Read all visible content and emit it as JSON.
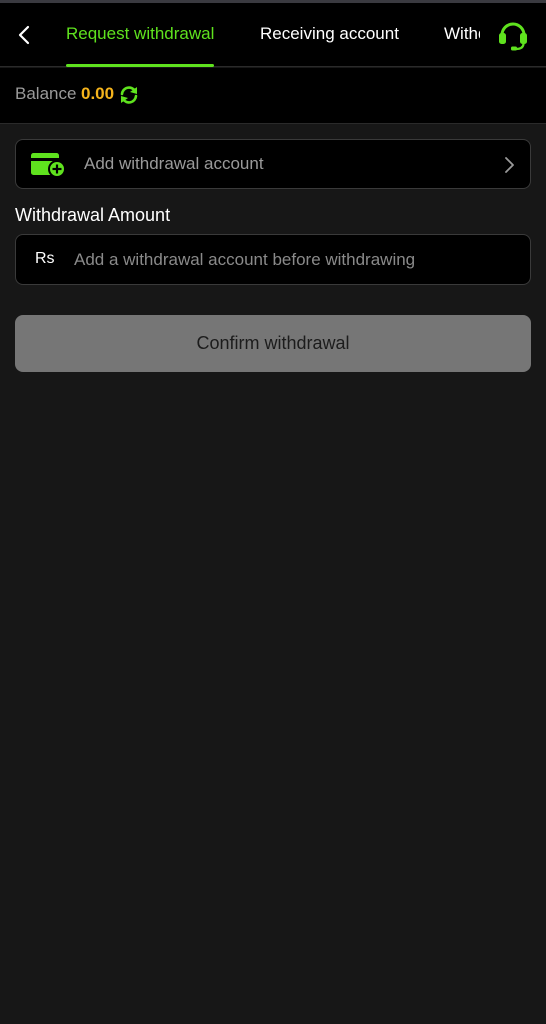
{
  "header": {
    "back_icon": "chevron-left-icon",
    "tabs": [
      {
        "label": "Request withdrawal",
        "active": true
      },
      {
        "label": "Receiving account",
        "active": false
      },
      {
        "label": "Withdrawal record",
        "active": false
      }
    ],
    "support_icon": "headset-icon"
  },
  "balance": {
    "label": "Balance",
    "value": "0.00",
    "refresh_icon": "refresh-icon"
  },
  "account": {
    "icon": "wallet-add-icon",
    "label": "Add withdrawal account",
    "chevron_icon": "chevron-right-icon"
  },
  "amount": {
    "title": "Withdrawal Amount",
    "currency": "Rs",
    "placeholder": "Add a withdrawal account before withdrawing"
  },
  "confirm": {
    "label": "Confirm withdrawal"
  },
  "colors": {
    "accent": "#5fe21e",
    "balance": "#f5b41c",
    "background": "#171717",
    "button_disabled": "#767676"
  }
}
